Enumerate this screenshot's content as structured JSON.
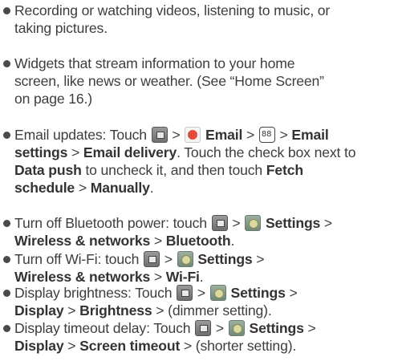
{
  "items": [
    {
      "lines": [
        [
          "Recording or watching videos, listening to music, or"
        ],
        [
          "taking pictures."
        ]
      ]
    },
    {
      "lines": [
        [
          "Widgets that stream information to your home"
        ],
        [
          "screen, like news or weather. (See “Home Screen”"
        ],
        [
          "on page 16.)"
        ]
      ]
    },
    {
      "lines": [
        [
          "Email updates: Touch ",
          {
            "icon": "menu-icon"
          },
          " > ",
          {
            "icon": "email-app-icon"
          },
          " ",
          {
            "b": "Email"
          },
          " > ",
          {
            "icon": "options-icon"
          },
          " > ",
          {
            "b": "Email"
          }
        ],
        [
          {
            "b": "settings"
          },
          " > ",
          {
            "b": "Email delivery"
          },
          ". Touch the check box next to"
        ],
        [
          {
            "b": "Data push"
          },
          " to uncheck it, and then touch ",
          {
            "b": "Fetch"
          }
        ],
        [
          {
            "b": "schedule"
          },
          " > ",
          {
            "b": "Manually"
          },
          "."
        ]
      ]
    },
    {
      "lines": [
        [
          "Turn off Bluetooth power: touch ",
          {
            "icon": "menu-icon"
          },
          " > ",
          {
            "icon": "settings-icon"
          },
          " ",
          {
            "b": "Settings"
          },
          " >"
        ],
        [
          {
            "b": "Wireless & networks"
          },
          " > ",
          {
            "b": "Bluetooth"
          },
          "."
        ]
      ]
    },
    {
      "lines": [
        [
          "Turn off Wi-Fi: touch ",
          {
            "icon": "menu-icon"
          },
          " > ",
          {
            "icon": "settings-icon"
          },
          " ",
          {
            "b": "Settings"
          },
          " >"
        ],
        [
          {
            "b": "Wireless & networks"
          },
          " > ",
          {
            "b": "Wi-Fi"
          },
          "."
        ]
      ]
    },
    {
      "lines": [
        [
          "Display brightness: Touch ",
          {
            "icon": "menu-icon"
          },
          " > ",
          {
            "icon": "settings-icon"
          },
          " ",
          {
            "b": "Settings"
          },
          " >"
        ],
        [
          {
            "b": "Display"
          },
          " > ",
          {
            "b": "Brightness"
          },
          " > (dimmer setting)."
        ]
      ]
    },
    {
      "lines": [
        [
          "Display timeout delay: Touch ",
          {
            "icon": "menu-icon"
          },
          " > ",
          {
            "icon": "settings-icon"
          },
          " ",
          {
            "b": "Settings"
          },
          " >"
        ],
        [
          {
            "b": "Display"
          },
          " > ",
          {
            "b": "Screen timeout"
          },
          " > (shorter setting)."
        ]
      ]
    }
  ]
}
